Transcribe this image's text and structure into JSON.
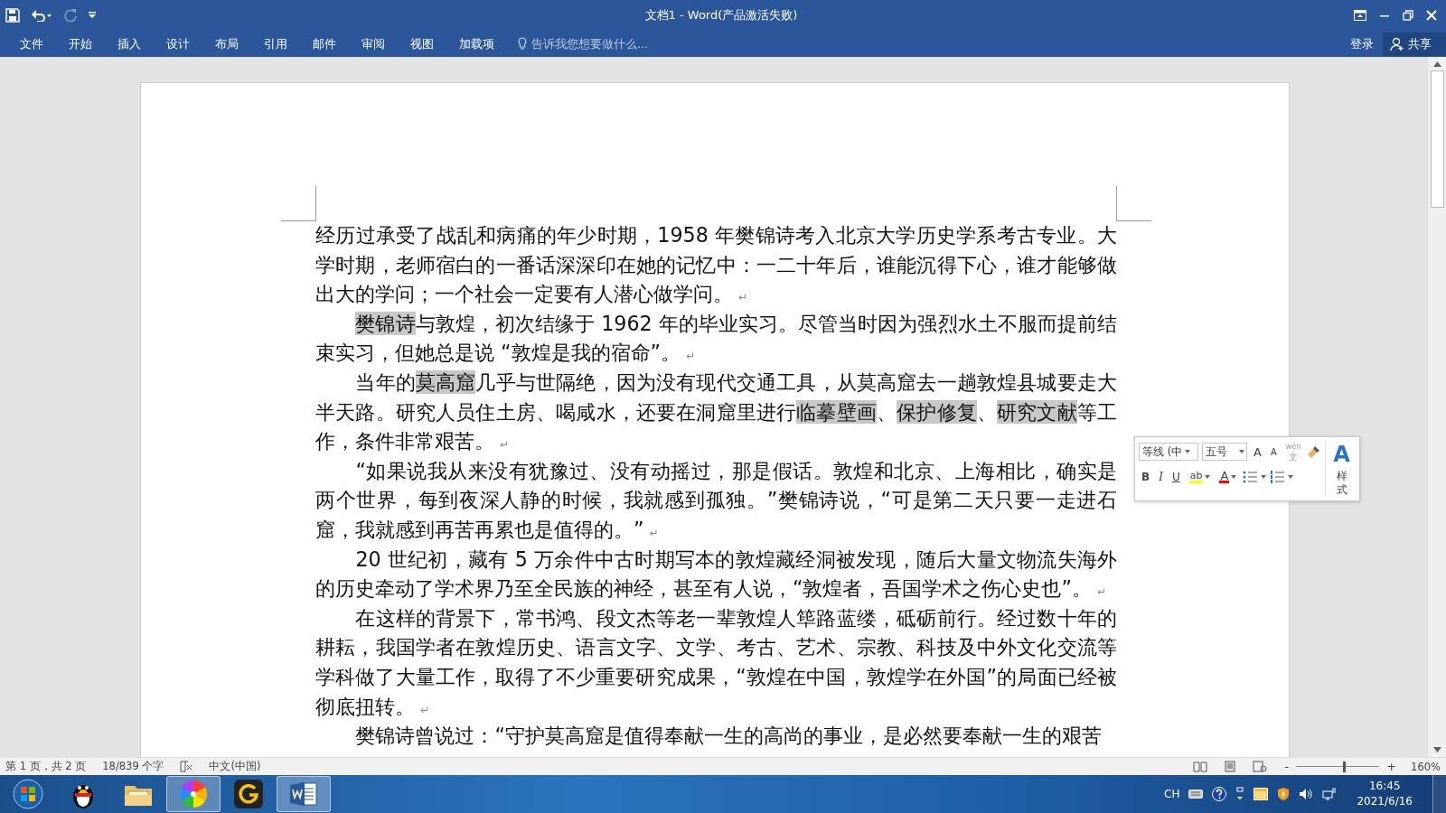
{
  "title_bar": {
    "title": "文档1 - Word(产品激活失败)"
  },
  "ribbon": {
    "tabs": [
      {
        "label": "文件",
        "selected": false
      },
      {
        "label": "开始",
        "selected": false
      },
      {
        "label": "插入",
        "selected": false
      },
      {
        "label": "设计",
        "selected": false
      },
      {
        "label": "布局",
        "selected": false
      },
      {
        "label": "引用",
        "selected": false
      },
      {
        "label": "邮件",
        "selected": false
      },
      {
        "label": "审阅",
        "selected": false
      },
      {
        "label": "视图",
        "selected": false
      },
      {
        "label": "加载项",
        "selected": false
      }
    ],
    "tell_me": {
      "placeholder": "告诉我您想要做什么..."
    },
    "sign_in": "登录",
    "share": "共享"
  },
  "document": {
    "paragraphs": [
      {
        "indent": false,
        "segments": [
          {
            "text": "经历过承受了战乱和病痛的年少时期，1958 年樊锦诗考入北京大学历史学系考古专业。大学时期，老师宿白的一番话深深印在她的记忆中：一二十年后，谁能沉得下心，谁才能够做出大的学问；一个社会一定要有人潜心做学问。",
            "highlight": false
          }
        ],
        "end_mark": "↵"
      },
      {
        "indent": true,
        "segments": [
          {
            "text": "樊锦诗",
            "highlight": true
          },
          {
            "text": "与敦煌，初次结缘于 1962 年的毕业实习。尽管当时因为强烈水土不服而提前结束实习，但她总是说 “敦煌是我的宿命”。",
            "highlight": false
          }
        ],
        "end_mark": "↵"
      },
      {
        "indent": true,
        "segments": [
          {
            "text": "当年的",
            "highlight": false
          },
          {
            "text": "莫高窟",
            "highlight": true
          },
          {
            "text": "几乎与世隔绝，因为没有现代交通工具，从莫高窟去一趟敦煌县城要走大半天路。研究人员住土房、喝咸水，还要在洞窟里进行",
            "highlight": false
          },
          {
            "text": "临摹壁画",
            "highlight": true
          },
          {
            "text": "、",
            "highlight": false
          },
          {
            "text": "保护修复",
            "highlight": true
          },
          {
            "text": "、",
            "highlight": false
          },
          {
            "text": "研究文献",
            "highlight": true
          },
          {
            "text": "等工作，条件非常艰苦。",
            "highlight": false
          }
        ],
        "end_mark": "↵"
      },
      {
        "indent": true,
        "segments": [
          {
            "text": "“如果说我从来没有犹豫过、没有动摇过，那是假话。敦煌和北京、上海相比，确实是两个世界，每到夜深人静的时候，我就感到孤独。”樊锦诗说，“可是第二天只要一走进石窟，我就感到再苦再累也是值得的。”",
            "highlight": false
          }
        ],
        "end_mark": "↵"
      },
      {
        "indent": true,
        "segments": [
          {
            "text": "20 世纪初，藏有 5 万余件中古时期写本的敦煌藏经洞被发现，随后大量文物流失海外的历史牵动了学术界乃至全民族的神经，甚至有人说，“敦煌者，吾国学术之伤心史也”。",
            "highlight": false
          }
        ],
        "end_mark": "↵"
      },
      {
        "indent": true,
        "segments": [
          {
            "text": "在这样的背景下，常书鸿、段文杰等老一辈敦煌人筚路蓝缕，砥砺前行。经过数十年的耕耘，我国学者在敦煌历史、语言文字、文学、考古、艺术、宗教、科技及中外文化交流等学科做了大量工作，取得了不少重要研究成果，“敦煌在中国，敦煌学在外国”的局面已经被彻底扭转。",
            "highlight": false
          }
        ],
        "end_mark": "↵"
      },
      {
        "indent": true,
        "segments": [
          {
            "text": "樊锦诗曾说过：“守护莫高窟是值得奉献一生的高尚的事业，是必然要奉献一生的艰苦",
            "highlight": false
          }
        ]
      }
    ]
  },
  "mini_toolbar": {
    "font": "等线 (中",
    "size": "五号",
    "grow_glyph": "A",
    "shrink_glyph": "A",
    "phonetic": {
      "top": "wén",
      "bottom": "文"
    },
    "format": [
      "B",
      "I",
      "U"
    ],
    "highlight": {
      "glyph": "ab",
      "color": "#ffff00"
    },
    "font_color": {
      "glyph": "A",
      "color": "#ff0000"
    },
    "styles": {
      "glyph": "A",
      "label": "样式"
    }
  },
  "status_bar": {
    "page": "第 1 页，共 2 页",
    "words": "18/839 个字",
    "language": "中文(中国)",
    "zoom": {
      "minus": "-",
      "plus": "+",
      "level": 0.57,
      "reading": "160%"
    }
  },
  "taskbar": {
    "apps": [
      {
        "selected": false
      },
      {
        "selected": false
      },
      {
        "selected": true
      },
      {
        "selected": false
      },
      {
        "selected": true
      }
    ],
    "ime": "CH",
    "time": "16:45",
    "date": "2021/6/16"
  }
}
